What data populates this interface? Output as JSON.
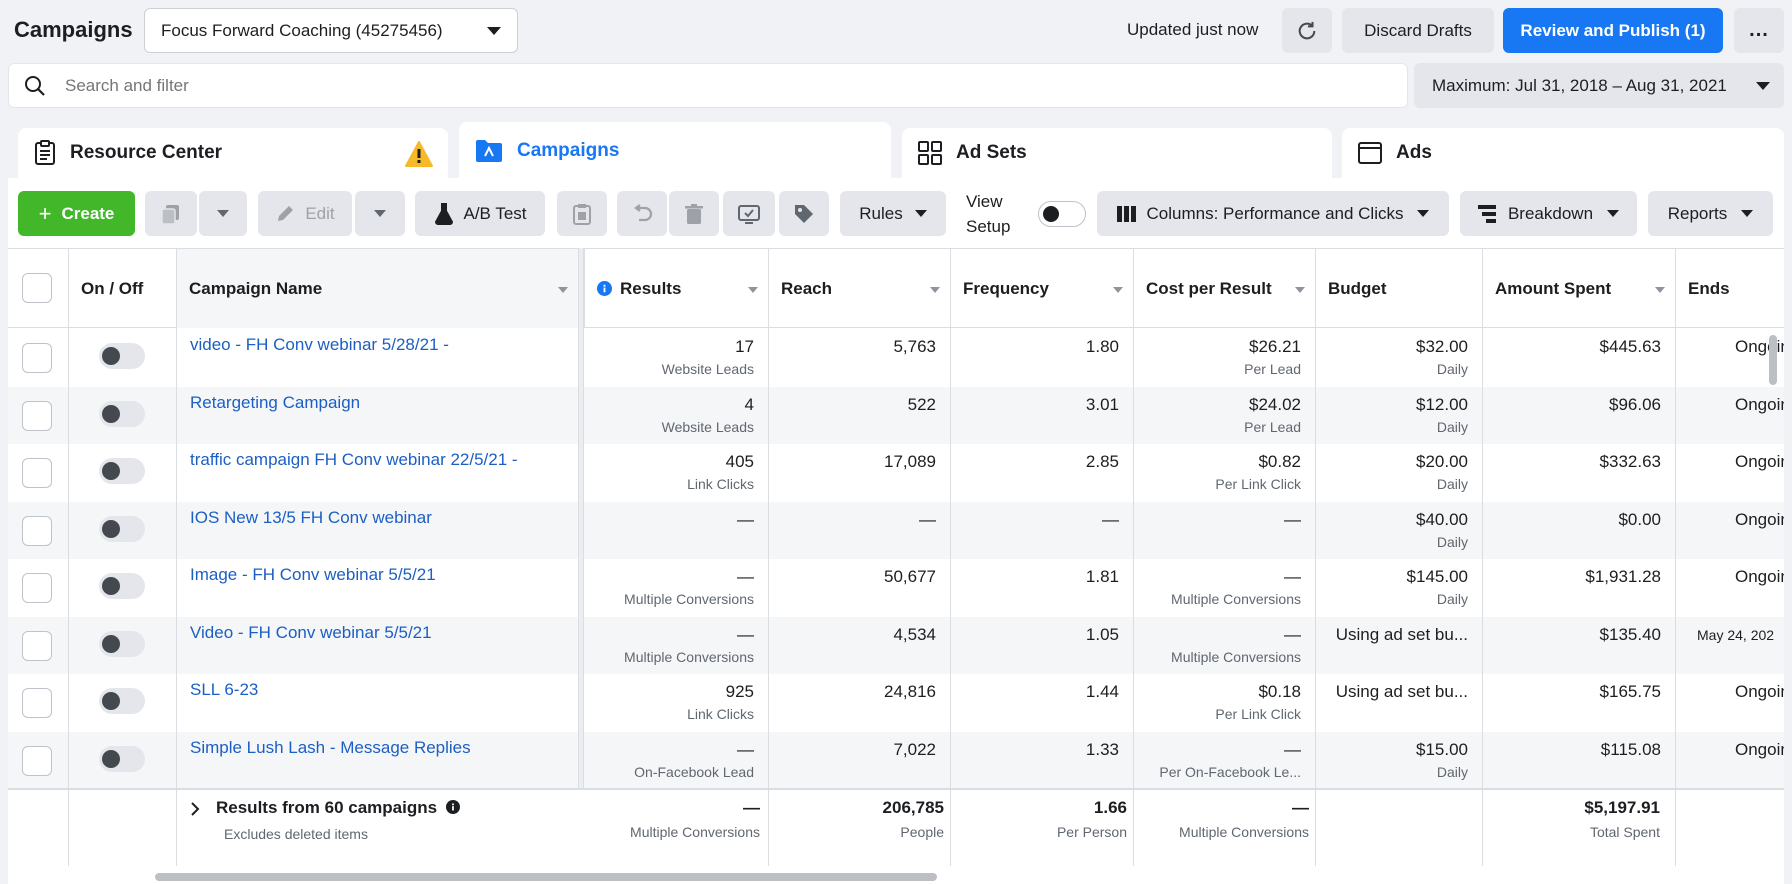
{
  "header": {
    "title": "Campaigns",
    "account": "Focus Forward Coaching (45275456)",
    "updated": "Updated just now",
    "discard": "Discard Drafts",
    "publish": "Review and Publish (1)",
    "more": "..."
  },
  "search": {
    "placeholder": "Search and filter",
    "date_range": "Maximum: Jul 31, 2018 – Aug 31, 2021"
  },
  "tabs": {
    "resource": "Resource Center",
    "campaigns": "Campaigns",
    "adsets": "Ad Sets",
    "ads": "Ads"
  },
  "toolbar": {
    "create": "Create",
    "edit": "Edit",
    "ab_test": "A/B Test",
    "rules": "Rules",
    "view_setup_1": "View",
    "view_setup_2": "Setup",
    "columns": "Columns: Performance and Clicks",
    "breakdown": "Breakdown",
    "reports": "Reports"
  },
  "columns": {
    "onoff": "On / Off",
    "name": "Campaign Name",
    "results": "Results",
    "reach": "Reach",
    "frequency": "Frequency",
    "cpr": "Cost per Result",
    "budget": "Budget",
    "spent": "Amount Spent",
    "ends": "Ends"
  },
  "rows": [
    {
      "name": "video - FH Conv webinar 5/28/21 -",
      "results": "17",
      "results_sub": "Website Leads",
      "reach": "5,763",
      "freq": "1.80",
      "cpr": "$26.21",
      "cpr_sub": "Per Lead",
      "budget": "$32.00",
      "budget_sub": "Daily",
      "spent": "$445.63",
      "ends": "Ongoin"
    },
    {
      "name": "Retargeting Campaign",
      "results": "4",
      "results_sub": "Website Leads",
      "reach": "522",
      "freq": "3.01",
      "cpr": "$24.02",
      "cpr_sub": "Per Lead",
      "budget": "$12.00",
      "budget_sub": "Daily",
      "spent": "$96.06",
      "ends": "Ongoin"
    },
    {
      "name": "traffic campaign FH Conv webinar 22/5/21 -",
      "results": "405",
      "results_sub": "Link Clicks",
      "reach": "17,089",
      "freq": "2.85",
      "cpr": "$0.82",
      "cpr_sub": "Per Link Click",
      "budget": "$20.00",
      "budget_sub": "Daily",
      "spent": "$332.63",
      "ends": "Ongoin"
    },
    {
      "name": "IOS New 13/5 FH Conv webinar",
      "results": "—",
      "results_sub": "",
      "reach": "—",
      "freq": "—",
      "cpr": "—",
      "cpr_sub": "",
      "budget": "$40.00",
      "budget_sub": "Daily",
      "spent": "$0.00",
      "ends": "Ongoin"
    },
    {
      "name": "Image - FH Conv webinar 5/5/21",
      "results": "—",
      "results_sub": "Multiple Conversions",
      "reach": "50,677",
      "freq": "1.81",
      "cpr": "—",
      "cpr_sub": "Multiple Conversions",
      "budget": "$145.00",
      "budget_sub": "Daily",
      "spent": "$1,931.28",
      "ends": "Ongoin"
    },
    {
      "name": "Video - FH Conv webinar 5/5/21",
      "results": "—",
      "results_sub": "Multiple Conversions",
      "reach": "4,534",
      "freq": "1.05",
      "cpr": "—",
      "cpr_sub": "Multiple Conversions",
      "budget": "Using ad set bu...",
      "budget_sub": "",
      "spent": "$135.40",
      "ends": "May 24, 202"
    },
    {
      "name": "SLL 6-23",
      "results": "925",
      "results_sub": "Link Clicks",
      "reach": "24,816",
      "freq": "1.44",
      "cpr": "$0.18",
      "cpr_sub": "Per Link Click",
      "budget": "Using ad set bu...",
      "budget_sub": "",
      "spent": "$165.75",
      "ends": "Ongoin"
    },
    {
      "name": "Simple Lush Lash - Message Replies",
      "results": "—",
      "results_sub": "On-Facebook Lead",
      "reach": "7,022",
      "freq": "1.33",
      "cpr": "—",
      "cpr_sub": "Per On-Facebook Le...",
      "budget": "$15.00",
      "budget_sub": "Daily",
      "spent": "$115.08",
      "ends": "Ongoin"
    }
  ],
  "summary": {
    "title": "Results from 60 campaigns",
    "sub": "Excludes deleted items",
    "results": "—",
    "results_sub": "Multiple Conversions",
    "reach": "206,785",
    "reach_sub": "People",
    "freq": "1.66",
    "freq_sub": "Per Person",
    "cpr": "—",
    "cpr_sub": "Multiple Conversions",
    "spent": "$5,197.91",
    "spent_sub": "Total Spent"
  },
  "colors": {
    "accent": "#1877f2",
    "create": "#42b72a",
    "link": "#1c5fc4"
  }
}
